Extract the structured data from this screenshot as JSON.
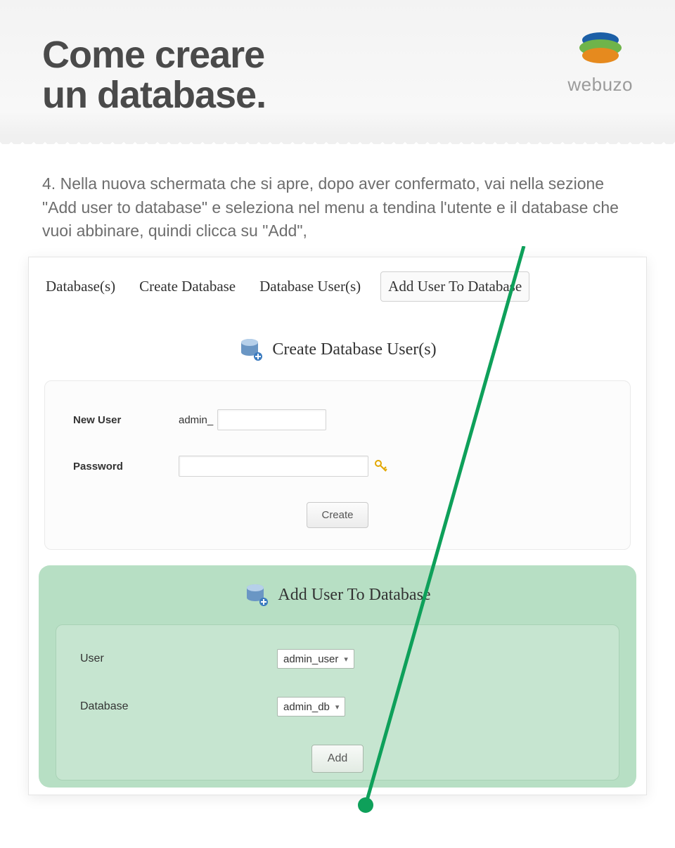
{
  "header": {
    "title_line1": "Come creare",
    "title_line2": "un database.",
    "brand": "webuzo"
  },
  "instruction": {
    "step": "4.",
    "text": "Nella nuova schermata che si apre, dopo aver confermato, vai nella sezione \"Add user to database\" e seleziona nel menu a tendina l'utente e il database che vuoi abbinare, quindi clicca su \"Add\","
  },
  "tabs": {
    "databases": "Database(s)",
    "create_db": "Create Database",
    "db_users": "Database User(s)",
    "add_user_db": "Add User To Database"
  },
  "section_create": {
    "title": "Create Database User(s)",
    "new_user_label": "New User",
    "prefix": "admin_",
    "password_label": "Password",
    "create_btn": "Create"
  },
  "section_add": {
    "title": "Add User To Database",
    "user_label": "User",
    "user_value": "admin_user",
    "db_label": "Database",
    "db_value": "admin_db",
    "add_btn": "Add"
  }
}
